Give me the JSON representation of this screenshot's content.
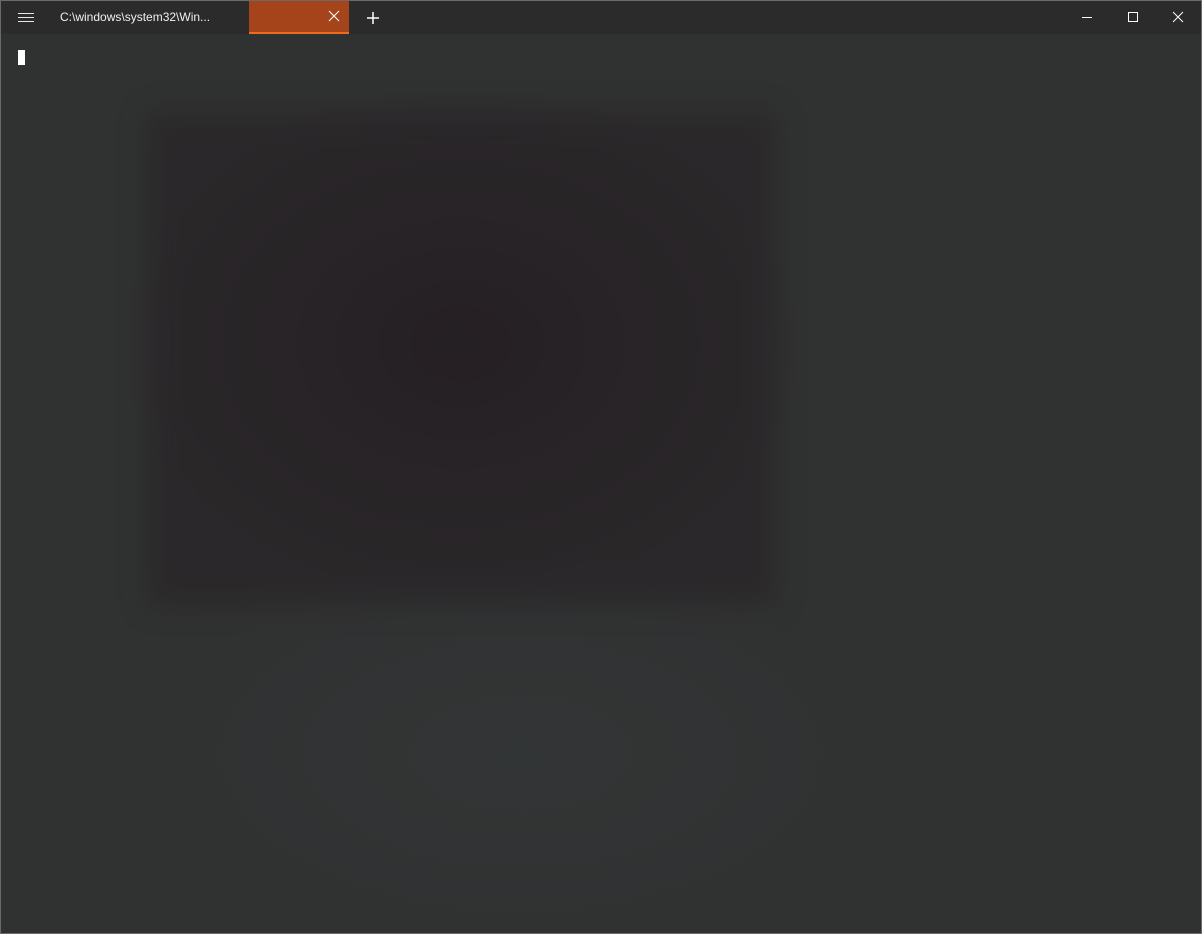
{
  "window": {
    "tabs": [
      {
        "title": "C:\\windows\\system32\\Win...",
        "active": false
      },
      {
        "title": "",
        "active": true
      }
    ]
  },
  "icons": {
    "menu": "hamburger-menu-icon",
    "tab_close": "close-icon",
    "new_tab": "plus-icon",
    "minimize": "minimize-icon",
    "maximize": "maximize-icon",
    "close": "close-icon"
  },
  "colors": {
    "titlebar": "#2b2b2b",
    "active_tab": "#a5441a",
    "active_tab_accent": "#f06a1e",
    "terminal_background": "#303131",
    "text": "#f0f0f0",
    "cursor": "#ffffff"
  }
}
